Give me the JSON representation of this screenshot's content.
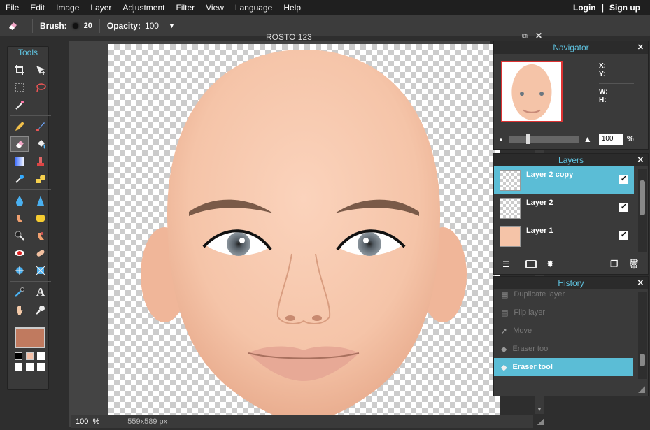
{
  "menu": {
    "items": [
      "File",
      "Edit",
      "Image",
      "Layer",
      "Adjustment",
      "Filter",
      "View",
      "Language",
      "Help"
    ],
    "login": "Login",
    "separator": "|",
    "signup": "Sign up"
  },
  "options": {
    "brush_label": "Brush:",
    "brush_size": "20",
    "opacity_label": "Opacity:",
    "opacity_value": "100"
  },
  "tools": {
    "title": "Tools",
    "foreground_color": "#c07a5f",
    "background_color": "#000000"
  },
  "document": {
    "title": "ROSTO 123",
    "zoom": "100",
    "zoom_unit": "%",
    "size": "559x589 px"
  },
  "navigator": {
    "title": "Navigator",
    "x_label": "X:",
    "y_label": "Y:",
    "w_label": "W:",
    "h_label": "H:",
    "zoom_value": "100",
    "zoom_unit": "%"
  },
  "layers": {
    "title": "Layers",
    "items": [
      {
        "name": "Layer 2 copy",
        "visible": true,
        "selected": true
      },
      {
        "name": "Layer 2",
        "visible": true,
        "selected": false
      },
      {
        "name": "Layer 1",
        "visible": true,
        "selected": false
      }
    ]
  },
  "history": {
    "title": "History",
    "items": [
      {
        "label": "Duplicate layer",
        "state": "dim"
      },
      {
        "label": "Flip layer",
        "state": "dim"
      },
      {
        "label": "Move",
        "state": "dim"
      },
      {
        "label": "Eraser tool",
        "state": "dim"
      },
      {
        "label": "Eraser tool",
        "state": "selected"
      }
    ]
  },
  "colors": {
    "accent": "#5bbdd6",
    "skin": "#f5c8ae"
  }
}
